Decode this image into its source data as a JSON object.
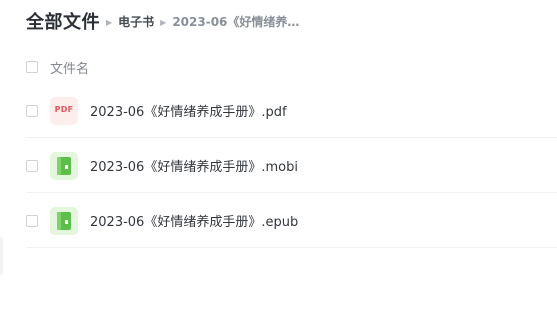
{
  "breadcrumb": {
    "root": "全部文件",
    "folder": "电子书",
    "current": "2023-06《好情绪养成..."
  },
  "list_header": {
    "name_label": "文件名"
  },
  "files": [
    {
      "name": "2023-06《好情绪养成手册》.pdf",
      "icon": "pdf-file-icon",
      "icon_text": "PDF"
    },
    {
      "name": "2023-06《好情绪养成手册》.mobi",
      "icon": "ebook-file-icon"
    },
    {
      "name": "2023-06《好情绪养成手册》.epub",
      "icon": "ebook-file-icon"
    }
  ],
  "colors": {
    "pdf_icon_bg": "#fdeeee",
    "pdf_icon_text": "#e25a5a",
    "ebook_icon_bg": "#e5f6df",
    "ebook_icon_fg": "#5cbf4a"
  }
}
